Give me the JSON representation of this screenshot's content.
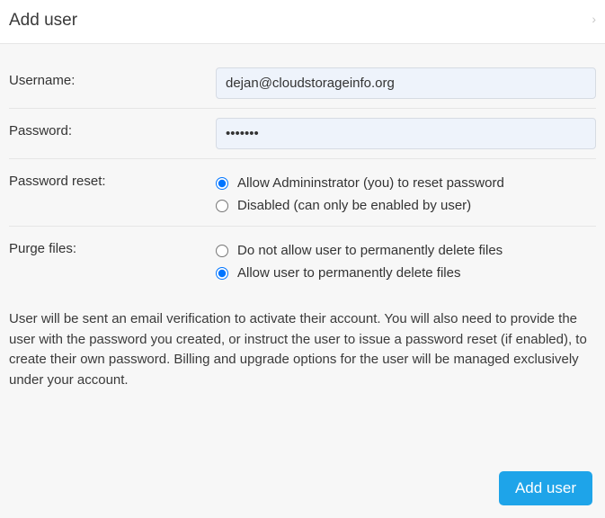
{
  "header": {
    "title": "Add user"
  },
  "username": {
    "label": "Username:",
    "value": "dejan@cloudstorageinfo.org"
  },
  "password": {
    "label": "Password:",
    "value": "•••••••"
  },
  "password_reset": {
    "label": "Password reset:",
    "options": [
      "Allow Admininstrator (you) to reset password",
      "Disabled (can only be enabled by user)"
    ],
    "selected": 0
  },
  "purge_files": {
    "label": "Purge files:",
    "options": [
      "Do not allow user to permanently delete files",
      "Allow user to permanently delete files"
    ],
    "selected": 1
  },
  "info_text": "User will be sent an email verification to activate their account. You will also need to provide the user with the password you created, or instruct the user to issue a password reset (if enabled), to create their own password. Billing and upgrade options for the user will be managed exclusively under your account.",
  "footer": {
    "submit_label": "Add user"
  }
}
